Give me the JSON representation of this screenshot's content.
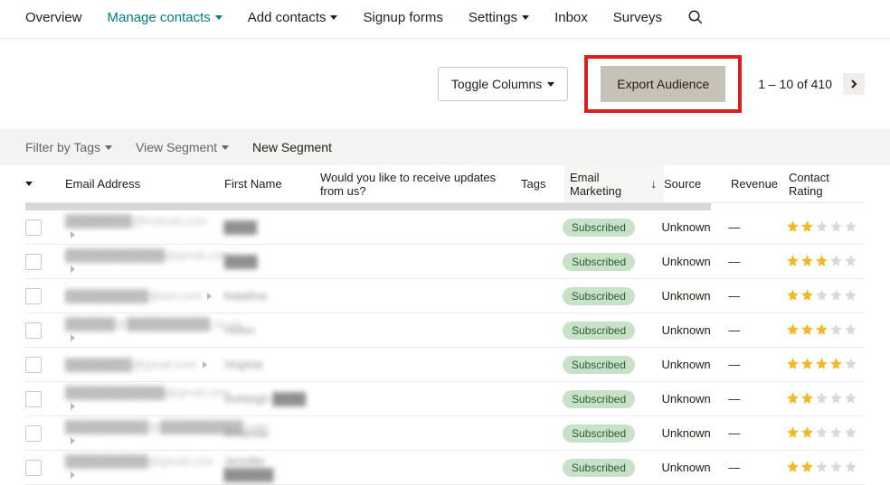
{
  "nav": {
    "overview": "Overview",
    "manage": "Manage contacts",
    "add": "Add contacts",
    "signup": "Signup forms",
    "settings": "Settings",
    "inbox": "Inbox",
    "surveys": "Surveys"
  },
  "toolbar": {
    "toggle_columns": "Toggle Columns",
    "export_audience": "Export Audience",
    "pagination_text": "1 – 10 of 410"
  },
  "segment": {
    "filter": "Filter by Tags",
    "view": "View Segment",
    "new": "New Segment"
  },
  "columns": {
    "email": "Email Address",
    "first": "First Name",
    "updates": "Would you like to receive updates from us?",
    "tags": "Tags",
    "emailmkt": "Email Marketing",
    "source": "Source",
    "revenue": "Revenue",
    "rating": "Contact Rating"
  },
  "rows": [
    {
      "email": "████████@hotmail.com",
      "first": "████",
      "status": "Subscribed",
      "source": "Unknown",
      "revenue": "—",
      "rating": 2
    },
    {
      "email": "████████████@gmail.com",
      "first": "████",
      "status": "Subscribed",
      "source": "Unknown",
      "revenue": "—",
      "rating": 3
    },
    {
      "email": "██████████@aol.com",
      "first": "Natalina",
      "status": "Subscribed",
      "source": "Unknown",
      "revenue": "—",
      "rating": 2
    },
    {
      "email": "██████@██████████.co.za",
      "first": "Helen",
      "status": "Subscribed",
      "source": "Unknown",
      "revenue": "—",
      "rating": 3
    },
    {
      "email": "████████@gmail.com",
      "first": "Virginia",
      "status": "Subscribed",
      "source": "Unknown",
      "revenue": "—",
      "rating": 4
    },
    {
      "email": "████████████@gmail.com",
      "first": "Ashleigh ████",
      "status": "Subscribed",
      "source": "Unknown",
      "revenue": "—",
      "rating": 2
    },
    {
      "email": "██████████@██████████.com",
      "first": "Amanda",
      "status": "Subscribed",
      "source": "Unknown",
      "revenue": "—",
      "rating": 2
    },
    {
      "email": "██████████@gmail.com",
      "first": "Jennifer ██████",
      "status": "Subscribed",
      "source": "Unknown",
      "revenue": "—",
      "rating": 2
    }
  ]
}
